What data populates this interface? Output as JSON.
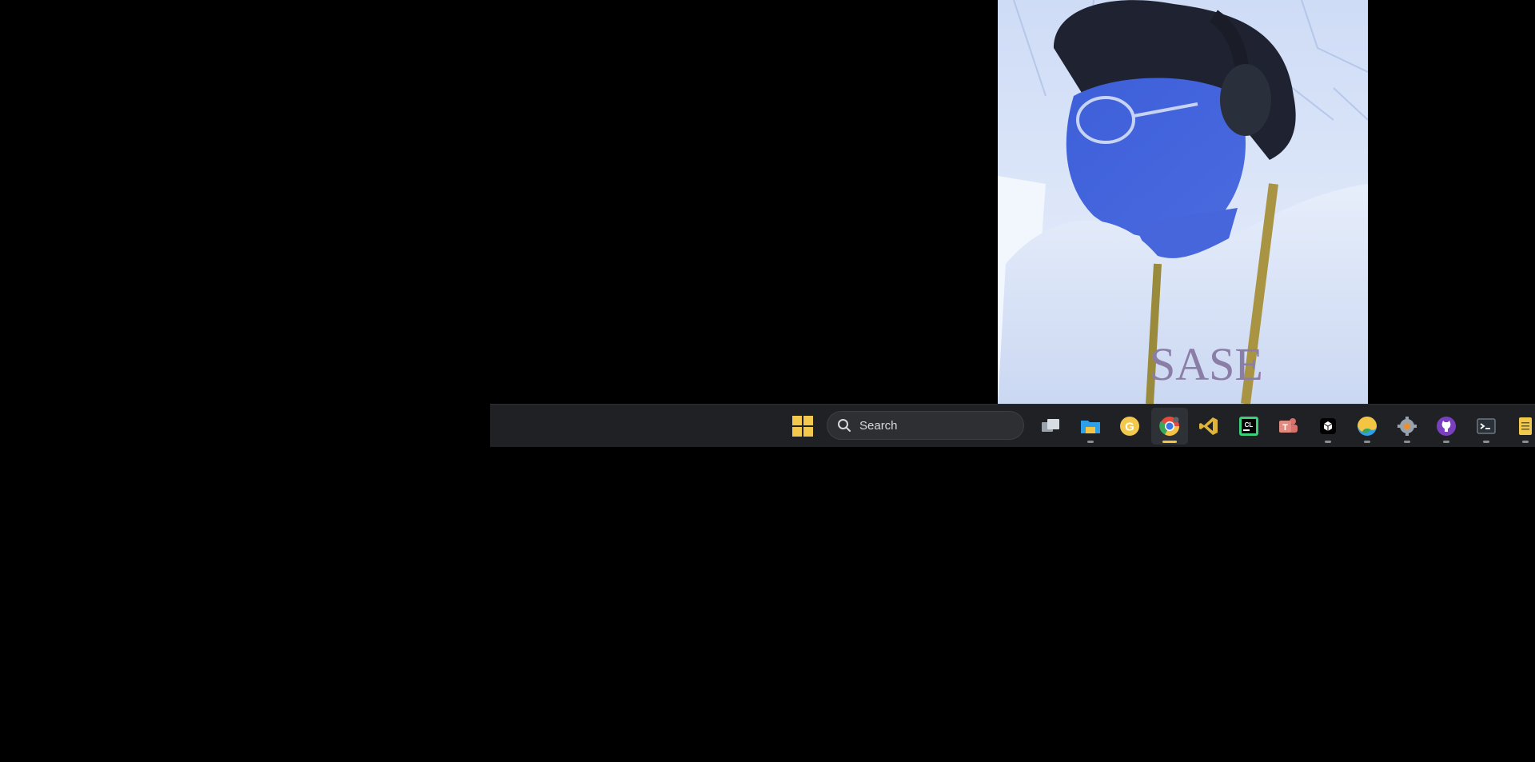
{
  "webcam": {
    "shirt_text": "SASE"
  },
  "taskbar": {
    "search_label": "Search",
    "apps": [
      {
        "name": "task-view-icon",
        "running": false,
        "active": false
      },
      {
        "name": "file-explorer-icon",
        "running": true,
        "active": false
      },
      {
        "name": "g-app-icon",
        "running": false,
        "active": false
      },
      {
        "name": "chrome-icon",
        "running": true,
        "active": true
      },
      {
        "name": "vscode-icon",
        "running": false,
        "active": false
      },
      {
        "name": "clion-icon",
        "running": false,
        "active": false
      },
      {
        "name": "teams-icon",
        "running": false,
        "active": false
      },
      {
        "name": "box-app-icon",
        "running": true,
        "active": false
      },
      {
        "name": "edge-icon",
        "running": true,
        "active": false
      },
      {
        "name": "settings-icon",
        "running": true,
        "active": false
      },
      {
        "name": "github-icon",
        "running": true,
        "active": false
      },
      {
        "name": "terminal-icon",
        "running": true,
        "active": false
      },
      {
        "name": "notepad-icon",
        "running": true,
        "active": false
      }
    ],
    "colors": {
      "taskbar_bg": "#1f2124",
      "active_indicator": "#f4c542",
      "start_accent": "#f2c94c"
    }
  }
}
